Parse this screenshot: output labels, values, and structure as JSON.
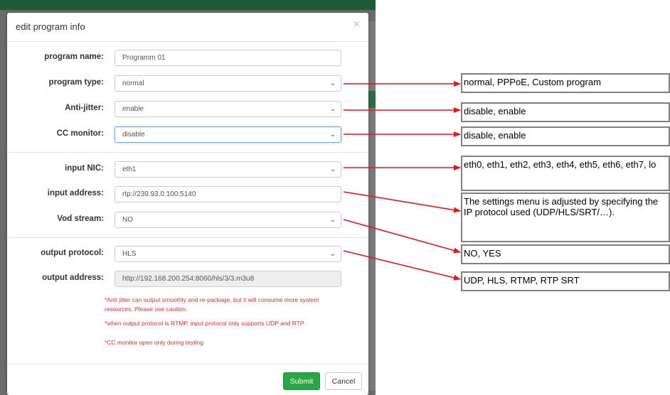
{
  "dialog": {
    "title": "edit program info",
    "close_glyph": "×",
    "fields": {
      "program_name": {
        "label": "program name:",
        "value": "Programm 01"
      },
      "program_type": {
        "label": "program type:",
        "value": "normal"
      },
      "anti_jitter": {
        "label": "Anti-jitter:",
        "value": "enable"
      },
      "cc_monitor": {
        "label": "CC monitor:",
        "value": "disable"
      },
      "input_nic": {
        "label": "input NIC:",
        "value": "eth1"
      },
      "input_address": {
        "label": "input address:",
        "value": "rtp://239.93.0.100:5140"
      },
      "vod_stream": {
        "label": "Vod stream:",
        "value": "NO"
      },
      "output_protocol": {
        "label": "output protocol:",
        "value": "HLS"
      },
      "output_address": {
        "label": "output address:",
        "value": "http://192.168.200.254:8060/hls/3/3.m3u8"
      }
    },
    "notes": [
      "*Anti jitter can output smoothly and re-package, but it will consume more system",
      "resources. Please use caution.",
      "*when output protocol is RTMP, input protocol only supports UDP and RTP .",
      "*CC monitor open only during testing"
    ],
    "buttons": {
      "submit": "Submit",
      "cancel": "Cancel"
    }
  },
  "callouts": {
    "program_type": "normal, PPPoE, Custom program",
    "anti_jitter": "disable, enable",
    "cc_monitor": "disable, enable",
    "input_nic": "eth0, eth1, eth2, eth3, eth4, eth5, eth6, eth7, lo",
    "input_address": "The settings menu is adjusted by specifying the IP protocol used (UDP/HLS/SRT/…).",
    "vod_stream": "NO, YES",
    "output_protocol": "UDP, HLS, RTMP, RTP SRT"
  },
  "icons": {
    "dropdown": "chevron-down-icon",
    "close": "close-icon"
  },
  "colors": {
    "arrow": "#e8141c",
    "submit": "#28a745",
    "note_text": "#e8322e",
    "focus_border": "#66afe9"
  }
}
